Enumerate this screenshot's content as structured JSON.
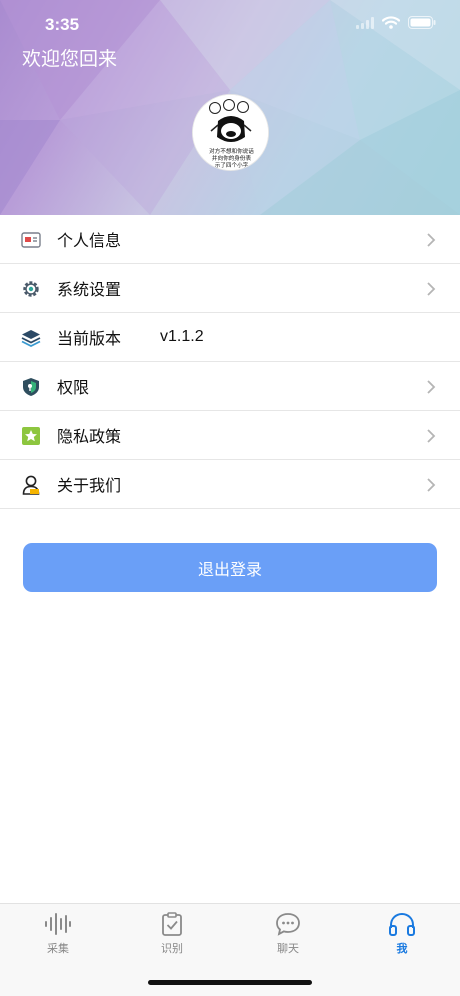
{
  "status": {
    "time": "3:35"
  },
  "header": {
    "welcome": "欢迎您回来"
  },
  "avatar": {
    "caption_lines": [
      "对方不想和你说话",
      "并向你的身份表",
      "示了四个小字"
    ]
  },
  "menu": {
    "items": [
      {
        "label": "个人信息",
        "icon": "id-card-icon",
        "chevron": true
      },
      {
        "label": "系统设置",
        "icon": "gear-icon",
        "chevron": true
      },
      {
        "label": "当前版本",
        "icon": "layers-icon",
        "value": "v1.1.2",
        "chevron": false
      },
      {
        "label": "权限",
        "icon": "shield-icon",
        "chevron": true
      },
      {
        "label": "隐私政策",
        "icon": "star-icon",
        "chevron": true
      },
      {
        "label": "关于我们",
        "icon": "user-icon",
        "chevron": true
      }
    ]
  },
  "logout": {
    "label": "退出登录"
  },
  "tabbar": {
    "tabs": [
      {
        "label": "采集",
        "icon": "waveform-icon",
        "active": false
      },
      {
        "label": "识别",
        "icon": "clipboard-check-icon",
        "active": false
      },
      {
        "label": "聊天",
        "icon": "chat-bubble-icon",
        "active": false
      },
      {
        "label": "我",
        "icon": "headphones-icon",
        "active": true
      }
    ]
  },
  "colors": {
    "accent": "#1a7ae0",
    "logout_button": "#6a9ff7",
    "header_gradient": [
      "#a98bd0",
      "#c8c4e2",
      "#a9d3df"
    ]
  }
}
